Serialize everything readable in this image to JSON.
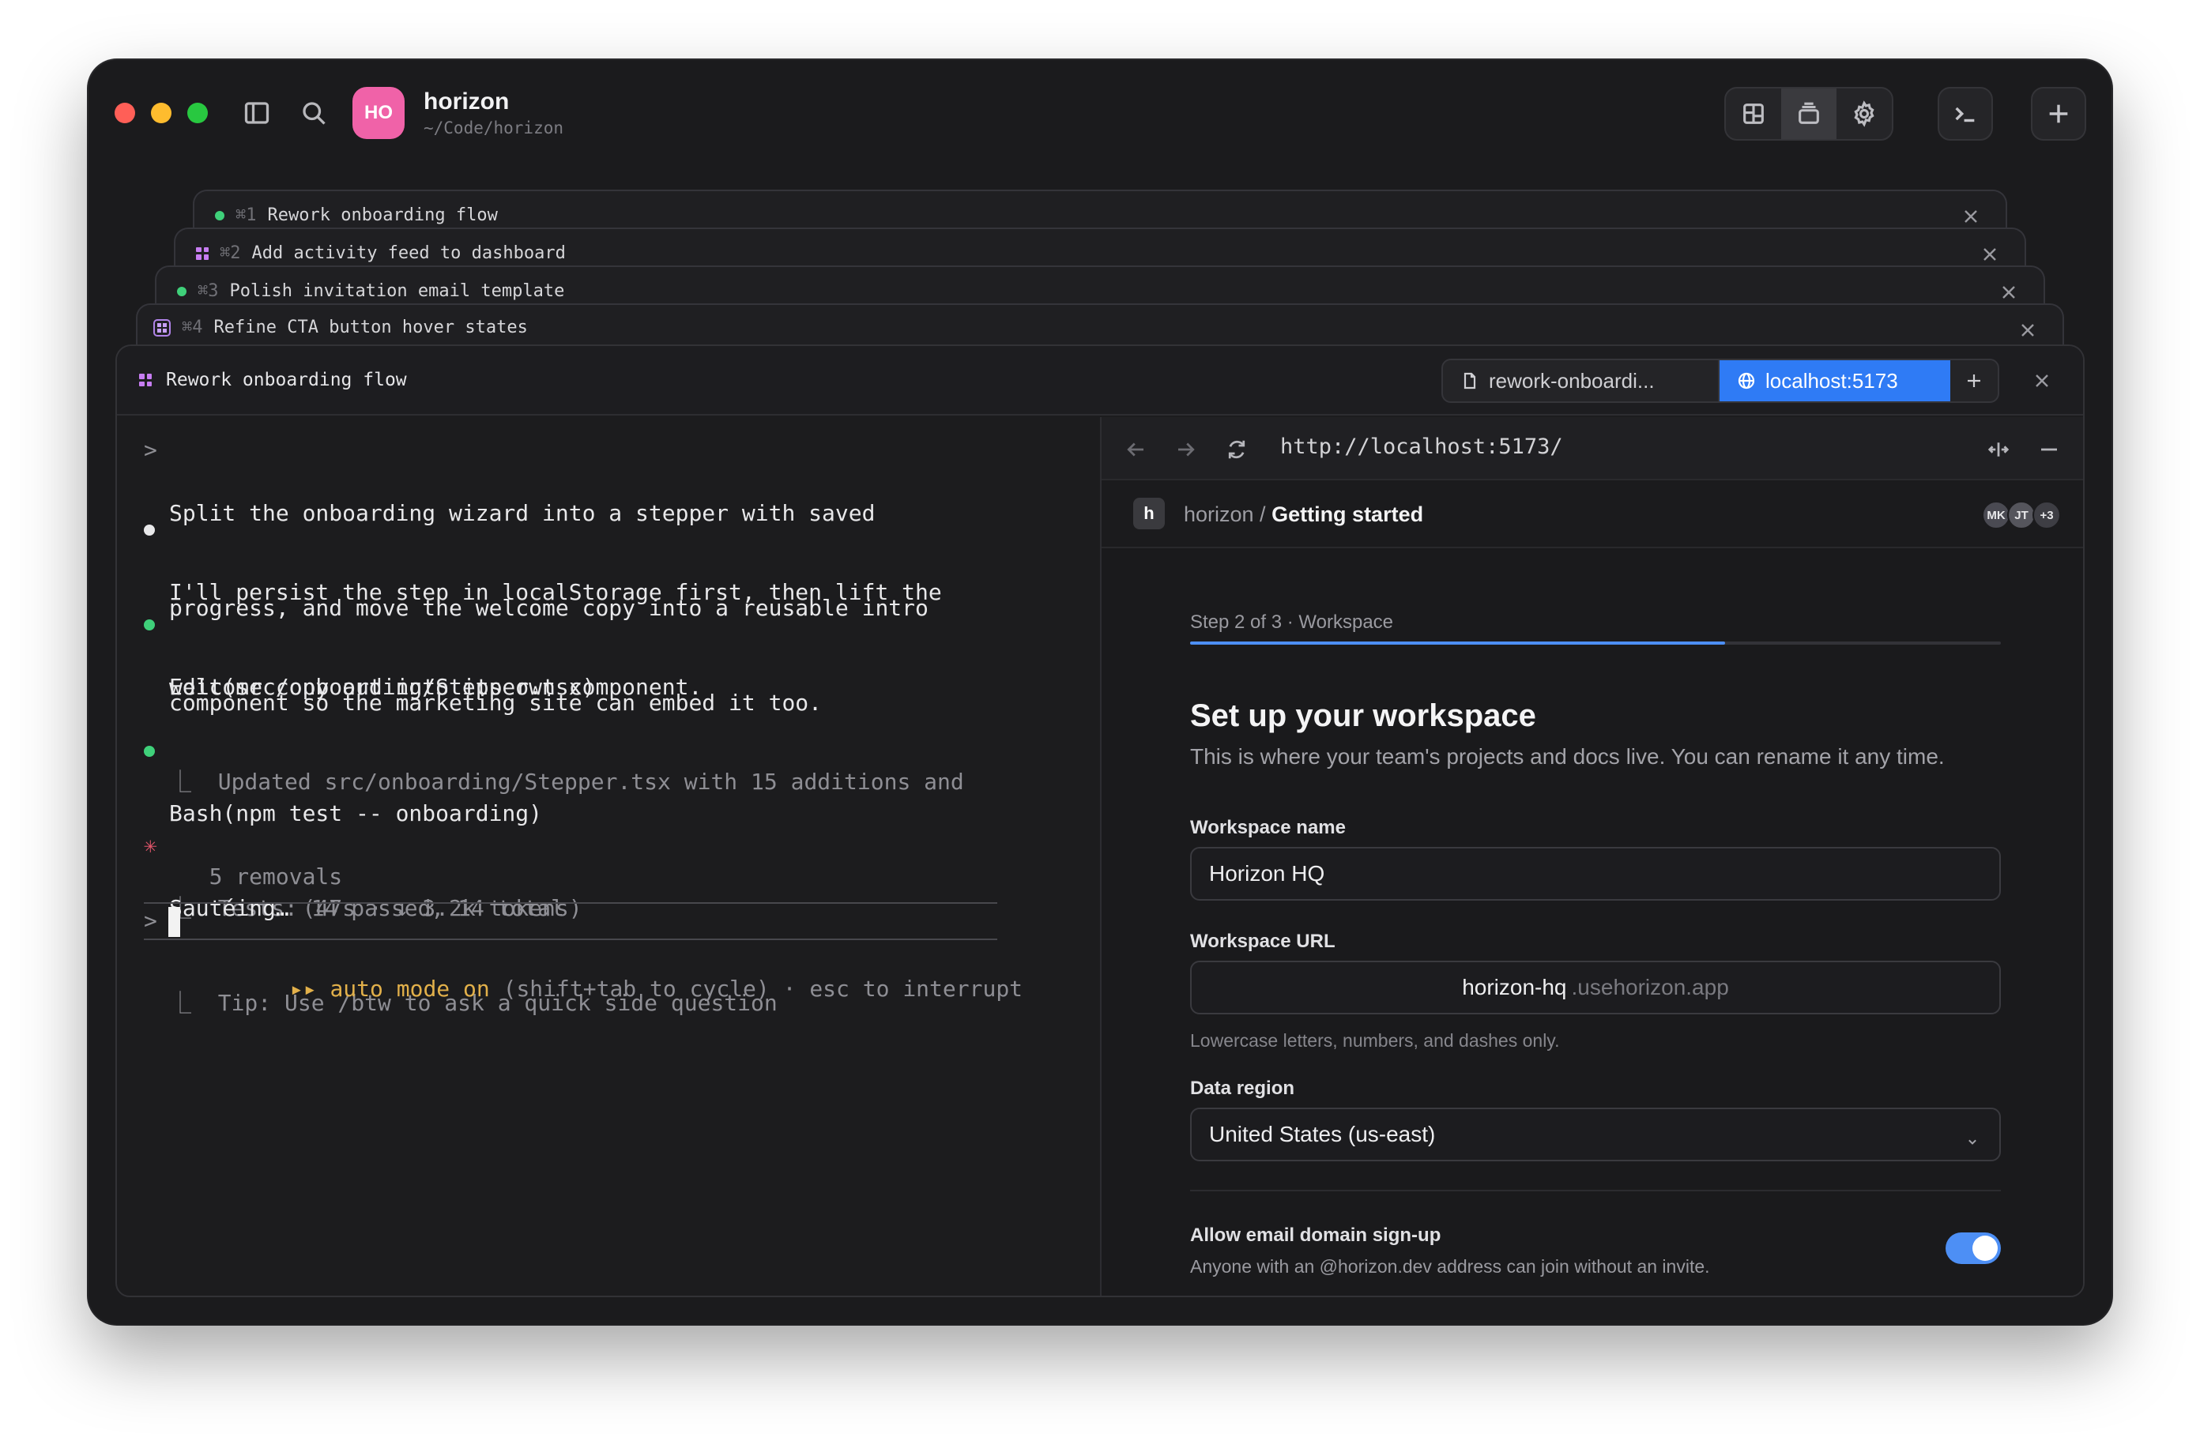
{
  "project": {
    "initials": "HO",
    "name": "horizon",
    "path": "~/Code/horizon"
  },
  "stack_tabs": [
    {
      "key": "⌘1",
      "title": "Rework onboarding flow"
    },
    {
      "key": "⌘2",
      "title": "Add activity feed to dashboard"
    },
    {
      "key": "⌘3",
      "title": "Polish invitation email template"
    },
    {
      "key": "⌘4",
      "title": "Refine CTA button hover states"
    }
  ],
  "panel": {
    "title": "Rework onboarding flow",
    "tabs": {
      "file": "rework-onboardi...",
      "browser": "localhost:5173"
    }
  },
  "terminal": {
    "prompt_mark": ">",
    "user_prompt": [
      "Split the onboarding wizard into a stepper with saved",
      "progress, and move the welcome copy into a reusable intro",
      "component so the marketing site can embed it too."
    ],
    "assistant": [
      "I'll persist the step in localStorage first, then lift the",
      "welcome copy out into its own component."
    ],
    "edit_call": "Edit(src/onboarding/Stepper.tsx)",
    "edit_result": [
      "⎿  Updated src/onboarding/Stepper.tsx with 15 additions and",
      "   5 removals"
    ],
    "bash_call": "Bash(npm test -- onboarding)",
    "bash_result": "⎿  Tests: 14 passed, 14 total",
    "status_glyph": "✳",
    "status_word": "Sautéing…",
    "status_meta": "(47s · ↓ 3.2k tokens)",
    "tip": "⎿  Tip: Use /btw to ask a quick side question",
    "input_prompt": ">",
    "mode_icon": "▸▸",
    "mode_label": "auto mode on",
    "mode_hint": "(shift+tab to cycle) · esc to interrupt"
  },
  "browser": {
    "url": "http://localhost:5173/",
    "app_logo": "h",
    "crumb_root": "horizon / ",
    "crumb_page": "Getting started",
    "avatars": [
      {
        "initials": "MK",
        "color": "#4a4a52"
      },
      {
        "initials": "JT",
        "color": "#55555c"
      },
      {
        "initials": "+3",
        "color": "#3e3e44"
      }
    ],
    "step_label": "Step 2 of 3 · Workspace",
    "progress_fraction": 0.66,
    "title": "Set up your workspace",
    "subtitle": "This is where your team's projects and docs live. You can rename it any time.",
    "workspace_name_label": "Workspace name",
    "workspace_name_value": "Horizon HQ",
    "workspace_url_label": "Workspace URL",
    "workspace_url_value": "horizon-hq",
    "workspace_url_suffix": ".usehorizon.app",
    "workspace_url_help": "Lowercase letters, numbers, and dashes only.",
    "region_label": "Data region",
    "region_value": "United States (us-east)",
    "signup_label": "Allow email domain sign-up",
    "signup_help": "Anyone with an @horizon.dev address can join without an invite.",
    "signup_enabled": true
  },
  "colors": {
    "accent": "#2f7bf5",
    "status_green": "#3fd07a",
    "mode_yellow": "#e2b04a",
    "spinner_red": "#e0556a",
    "avatar_pink": "#f062a8"
  }
}
